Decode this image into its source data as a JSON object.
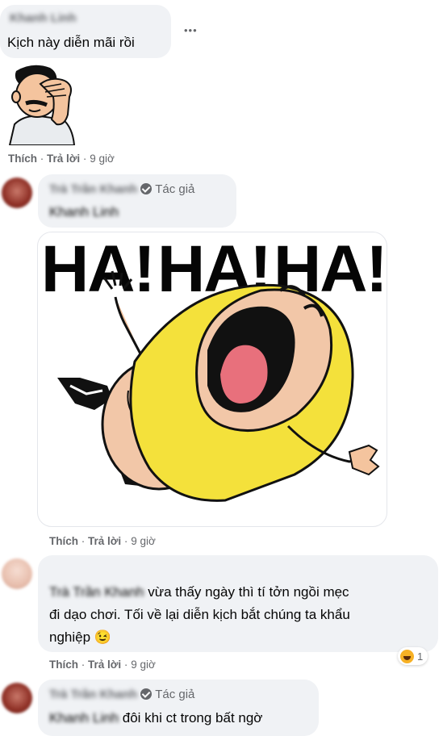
{
  "comments": [
    {
      "name": "Khanh Linh",
      "text": "Kịch này diễn mãi rồi",
      "more": "•••"
    },
    {
      "name": "Trà Trần Khanh",
      "badge": "Tác giả",
      "mention": "Khanh Linh"
    },
    {
      "mention": "Trà Trần Khanh",
      "text1": "vừa thấy ngày thì tí tởn ngồi mẹc",
      "text2": "đi dạo chơi. Tối về lại diễn kịch bắt chúng ta khẩu",
      "text3": "nghiệp",
      "emoji": "😉",
      "reaction_count": "1"
    },
    {
      "name": "Trà Trần Khanh",
      "badge": "Tác giả",
      "mention": "Khanh Linh",
      "text": "đôi khi ct trong bất ngờ"
    }
  ],
  "actions": {
    "like": "Thích",
    "reply": "Trả lời",
    "sep": "·",
    "time": "9 giờ"
  },
  "sticker": {
    "word1": "HA!",
    "word2": "HA!",
    "word3": "HA!"
  }
}
